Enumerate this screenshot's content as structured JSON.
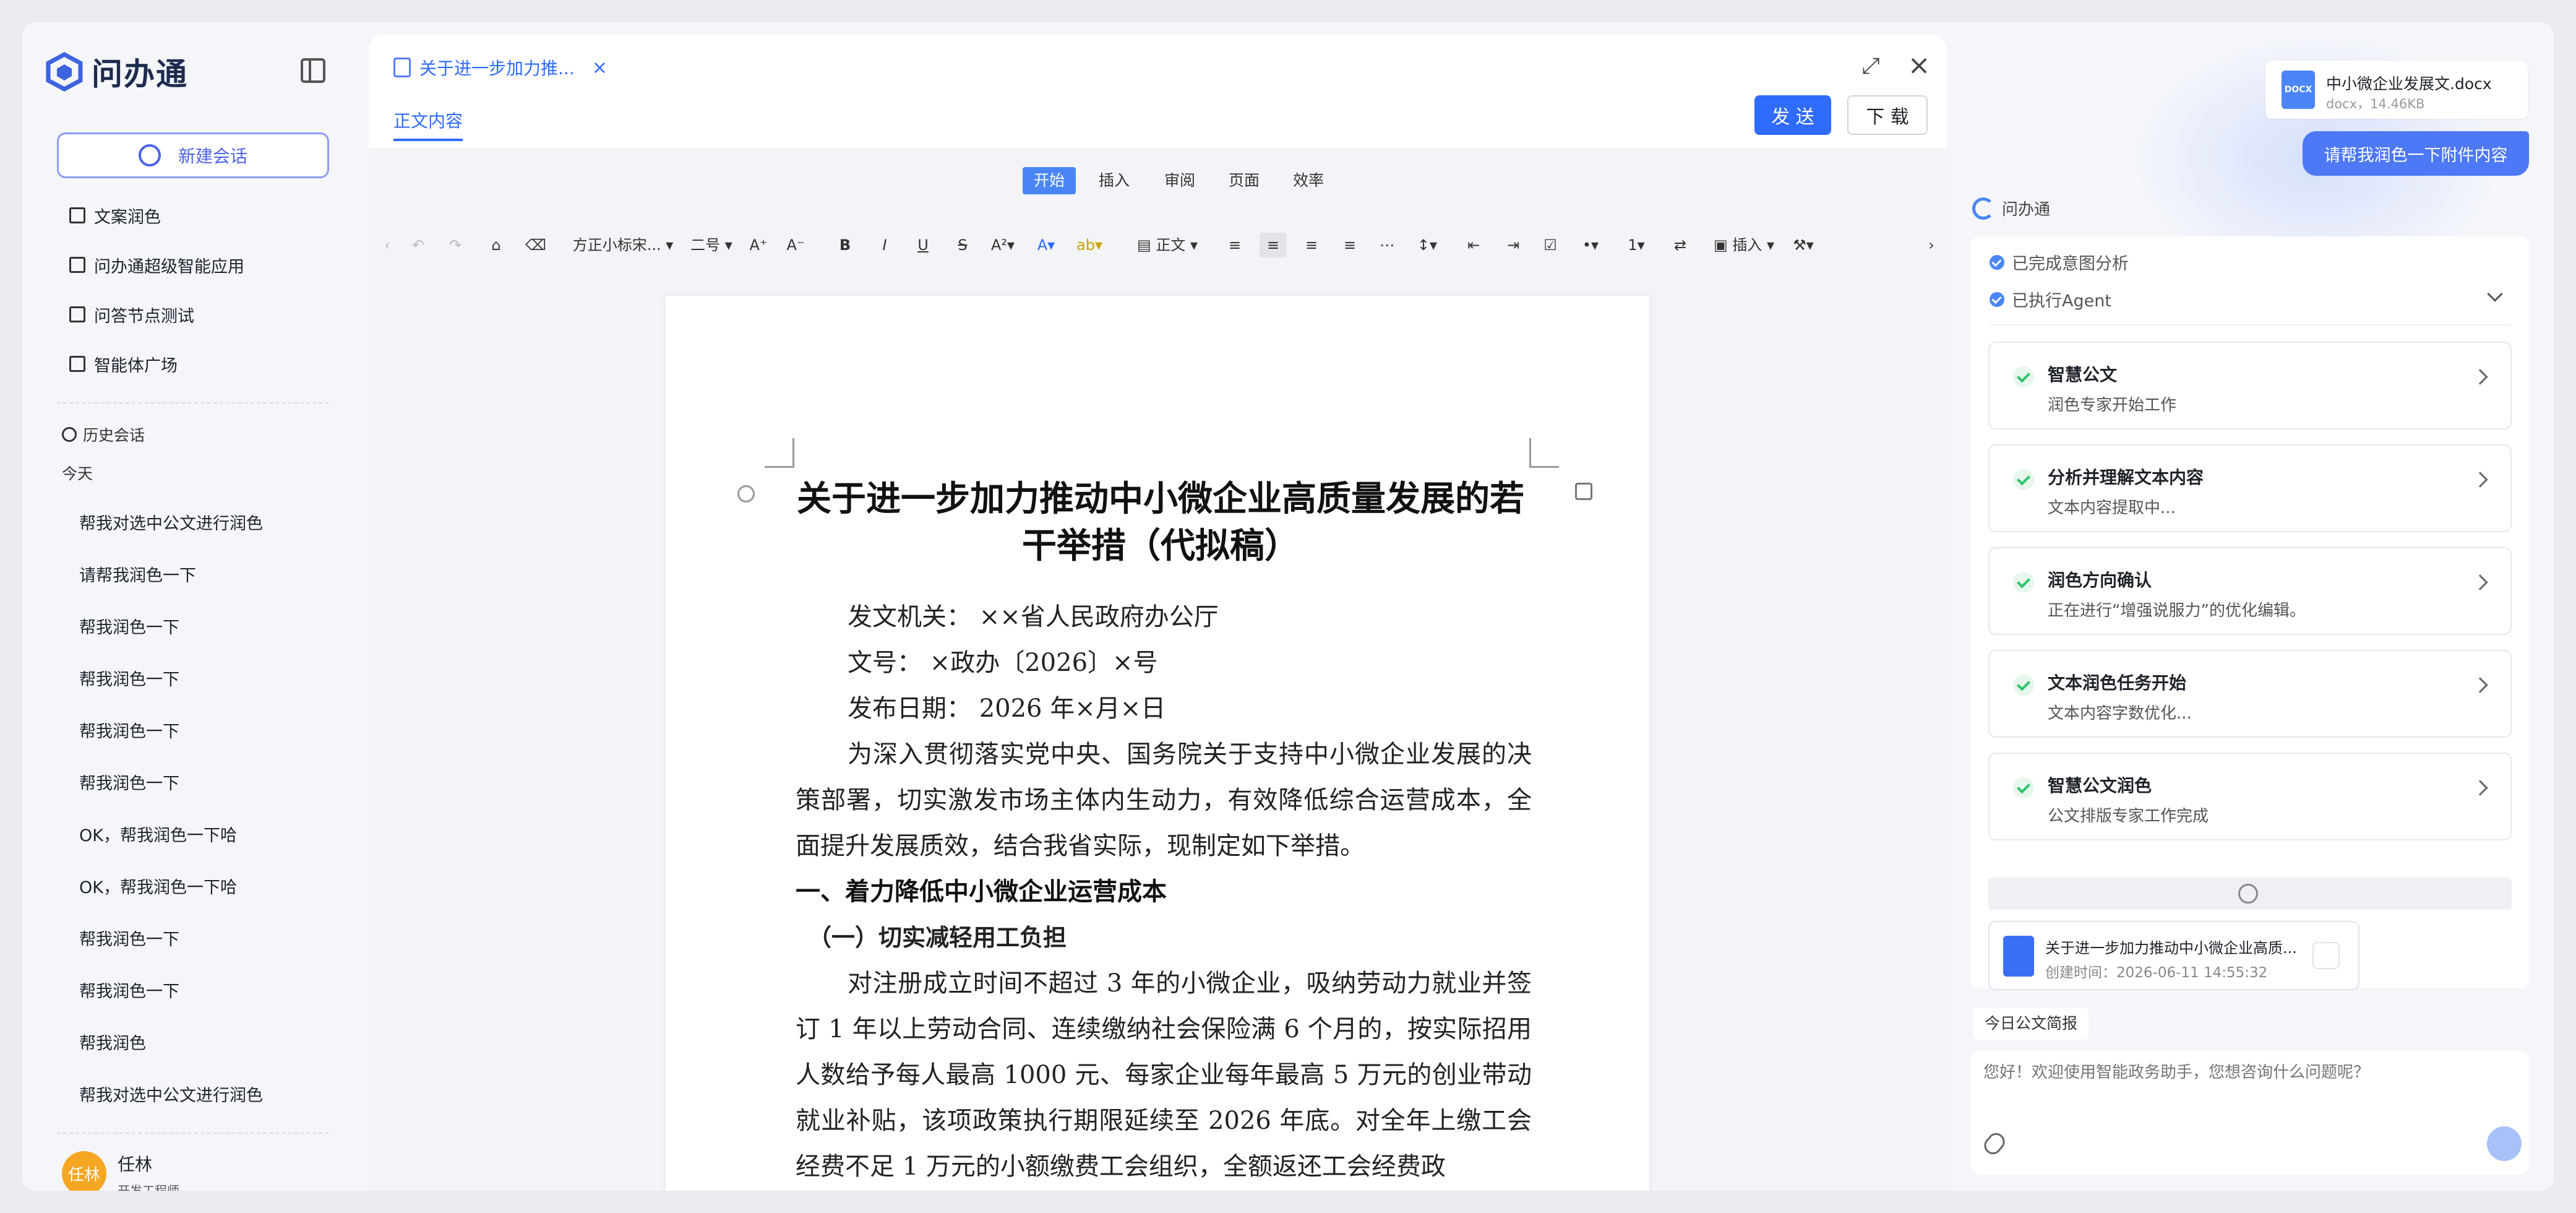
{
  "app": {
    "name": "问办通"
  },
  "sidebar": {
    "new_chat": "新建会话",
    "menu": [
      "文案润色",
      "问办通超级智能应用",
      "问答节点测试",
      "智能体广场"
    ],
    "history_label": "历史会话",
    "today_label": "今天",
    "history": [
      "帮我对选中公文进行润色",
      "请帮我润色一下",
      "帮我润色一下",
      "帮我润色一下",
      "帮我润色一下",
      "帮我润色一下",
      "OK，帮我润色一下哈",
      "OK，帮我润色一下哈",
      "帮我润色一下",
      "帮我润色一下",
      "帮我润色",
      "帮我对选中公文进行润色"
    ],
    "user": {
      "avatar": "任林",
      "name": "任林",
      "role": "开发工程师"
    }
  },
  "editor": {
    "tab_title": "关于进一步加力推...",
    "doc_tab": "正文内容",
    "send_label": "发 送",
    "download_label": "下 载",
    "ribbon_tabs": [
      "开始",
      "插入",
      "审阅",
      "页面",
      "效率"
    ],
    "active_ribbon": "开始",
    "toolbar": {
      "font": "方正小标宋...",
      "size": "二号",
      "style": "正文",
      "insert": "插入"
    },
    "document": {
      "title": "关于进一步加力推动中小微企业高质量发展的若干举措（代拟稿）",
      "issuer": "发文机关：  ××省人民政府办公厅",
      "number": "文号：  ×政办〔2026〕×号",
      "date": "发布日期：  2026 年×月×日",
      "intro": "为深入贯彻落实党中央、国务院关于支持中小微企业发展的决策部署，切实激发市场主体内生动力，有效降低综合运营成本，全面提升发展质效，结合我省实际，现制定如下举措。",
      "h1": "一、着力降低中小微企业运营成本",
      "h2": "（一）切实减轻用工负担",
      "p1": "对注册成立时间不超过 3 年的小微企业，吸纳劳动力就业并签订 1 年以上劳动合同、连续缴纳社会保险满 6 个月的，按实际招用人数给予每人最高 1000 元、每家企业每年最高 5 万元的创业带动就业补贴，该项政策执行期限延续至 2026 年底。对全年上缴工会经费不足 1 万元的小额缴费工会组织，全额返还工会经费政"
    }
  },
  "assistant": {
    "file": {
      "name": "中小微企业发展文.docx",
      "meta": "docx，14.46KB"
    },
    "user_message": "请帮我润色一下附件内容",
    "bot_name": "问办通",
    "status": [
      "已完成意图分析",
      "已执行Agent"
    ],
    "steps": [
      {
        "title": "智慧公文",
        "sub": "润色专家开始工作"
      },
      {
        "title": "分析并理解文本内容",
        "sub": "文本内容提取中..."
      },
      {
        "title": "润色方向确认",
        "sub": "正在进行“增强说服力”的优化编辑。"
      },
      {
        "title": "文本润色任务开始",
        "sub": "文本内容字数优化..."
      },
      {
        "title": "智慧公文润色",
        "sub": "公文排版专家工作完成"
      }
    ],
    "attachment": {
      "name": "关于进一步加力推动中小微企业高质...",
      "created": "创建时间：2026-06-11 14:55:32"
    },
    "brief": "今日公文简报",
    "input_placeholder": "您好！欢迎使用智能政务助手，您想咨询什么问题呢？"
  }
}
